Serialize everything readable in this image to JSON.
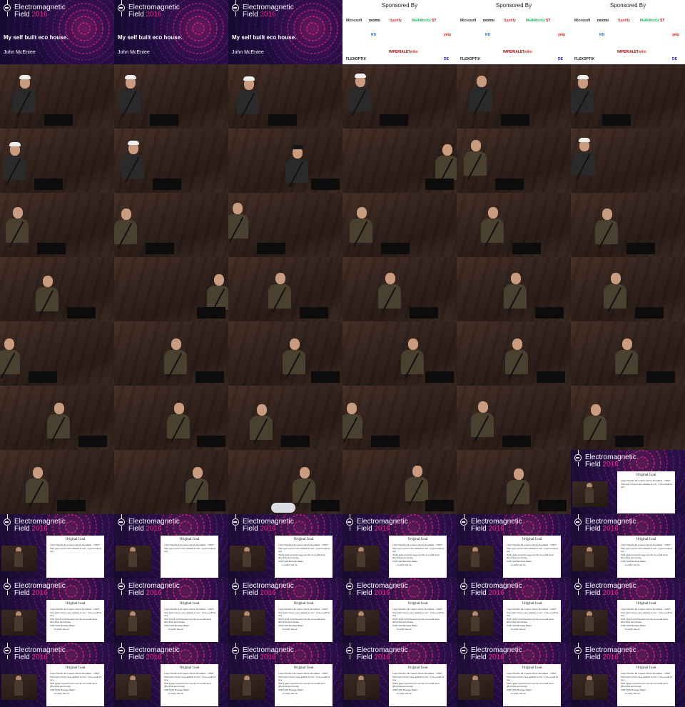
{
  "event": {
    "name_line1": "Electromagnetic",
    "name_line2": "Field",
    "year": "2016",
    "talk_title": "My self built eco house.",
    "speaker": "John McEntee"
  },
  "sponsors": {
    "heading": "Sponsored By",
    "logos": [
      "Microsoft",
      "nexmo",
      "Spotify",
      "MathWorks",
      "ST",
      "RS",
      "yelp",
      "IMPERIALE",
      "Twilio",
      "FLEXOPTIX",
      "DE"
    ]
  },
  "slide": {
    "title": "Original Goal",
    "bullets": [
      "Large Variable Air Capture and air Document – 250m²",
      "Well easy to have a few animals to roll – I was would be nice",
      "Well I guess would be less easy the we would never afford this and a house",
      "With Chief Heritage Maker",
      "– Is easily site too"
    ],
    "bullets_short": [
      "Large Variable Air Capture and air Document – 250m²",
      "Well easy to have a few animals to roll – I was would be nice"
    ]
  },
  "colors": {
    "event_background": "#140a2e",
    "event_accent": "#e4288a",
    "stage_background": "#34241e"
  }
}
